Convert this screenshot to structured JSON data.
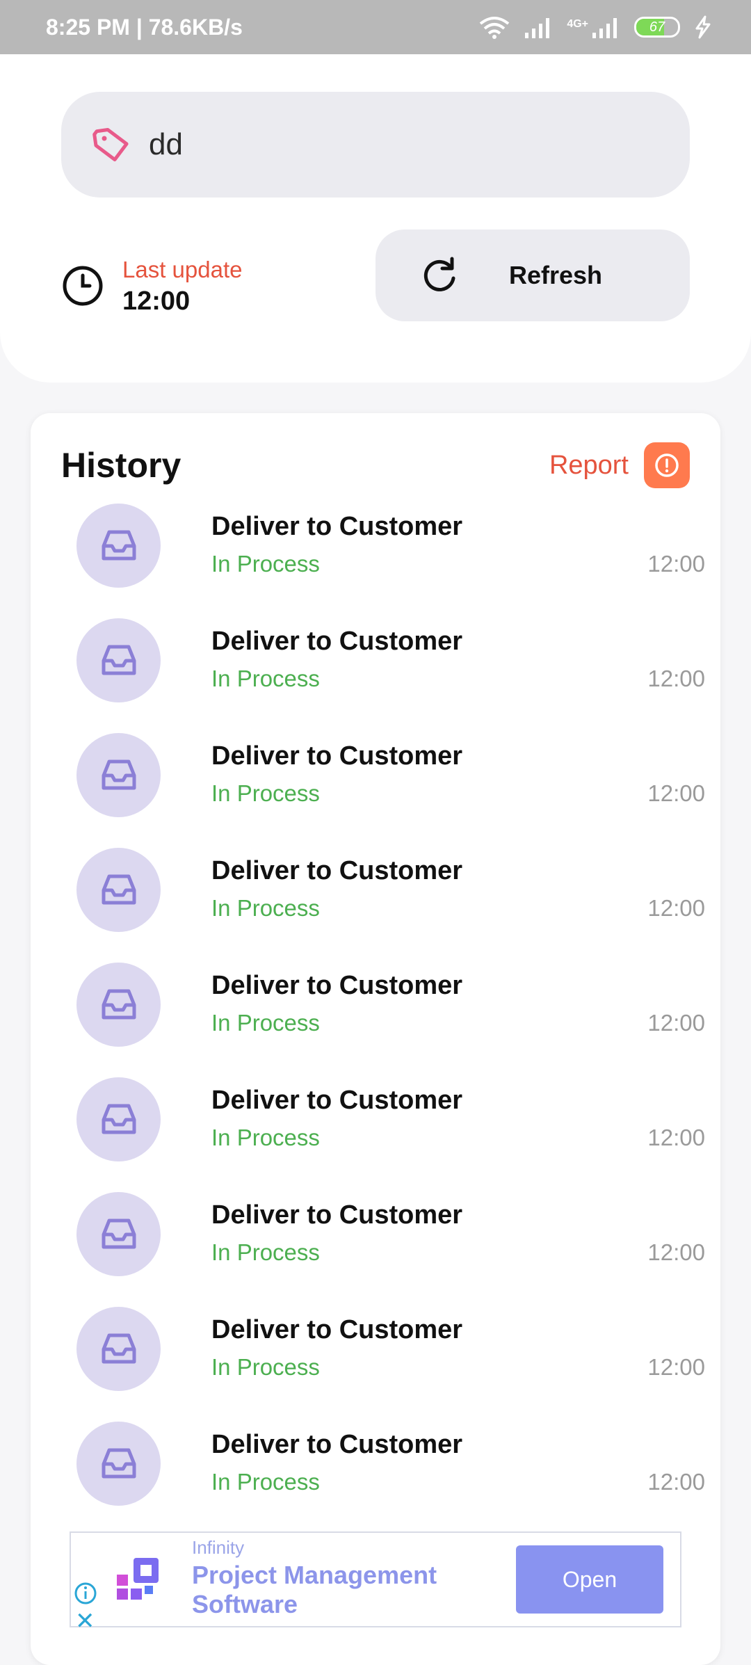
{
  "status_bar": {
    "time_speed": "8:25 PM | 78.6KB/s",
    "network": "4G+",
    "battery": "67"
  },
  "search": {
    "value": "dd"
  },
  "update": {
    "label": "Last update",
    "time": "12:00"
  },
  "refresh": {
    "label": "Refresh"
  },
  "history": {
    "title": "History",
    "report_label": "Report",
    "items": [
      {
        "title": "Deliver to Customer",
        "status": "In Process",
        "time": "12:00"
      },
      {
        "title": "Deliver to Customer",
        "status": "In Process",
        "time": "12:00"
      },
      {
        "title": "Deliver to Customer",
        "status": "In Process",
        "time": "12:00"
      },
      {
        "title": "Deliver to Customer",
        "status": "In Process",
        "time": "12:00"
      },
      {
        "title": "Deliver to Customer",
        "status": "In Process",
        "time": "12:00"
      },
      {
        "title": "Deliver to Customer",
        "status": "In Process",
        "time": "12:00"
      },
      {
        "title": "Deliver to Customer",
        "status": "In Process",
        "time": "12:00"
      },
      {
        "title": "Deliver to Customer",
        "status": "In Process",
        "time": "12:00"
      },
      {
        "title": "Deliver to Customer",
        "status": "In Process",
        "time": "12:00"
      }
    ]
  },
  "ad": {
    "advertiser": "Infinity",
    "headline": "Project Management Software",
    "cta": "Open"
  },
  "colors": {
    "accent_red": "#e5533d",
    "status_green": "#4caf50",
    "icon_purple": "#8b7fd6",
    "report_orange": "#ff7a4e"
  },
  "icons": {
    "search_field": "tag-icon",
    "update": "clock-icon",
    "refresh": "refresh-icon",
    "report": "alert-circle-icon",
    "history_item": "inbox-tray-icon"
  }
}
